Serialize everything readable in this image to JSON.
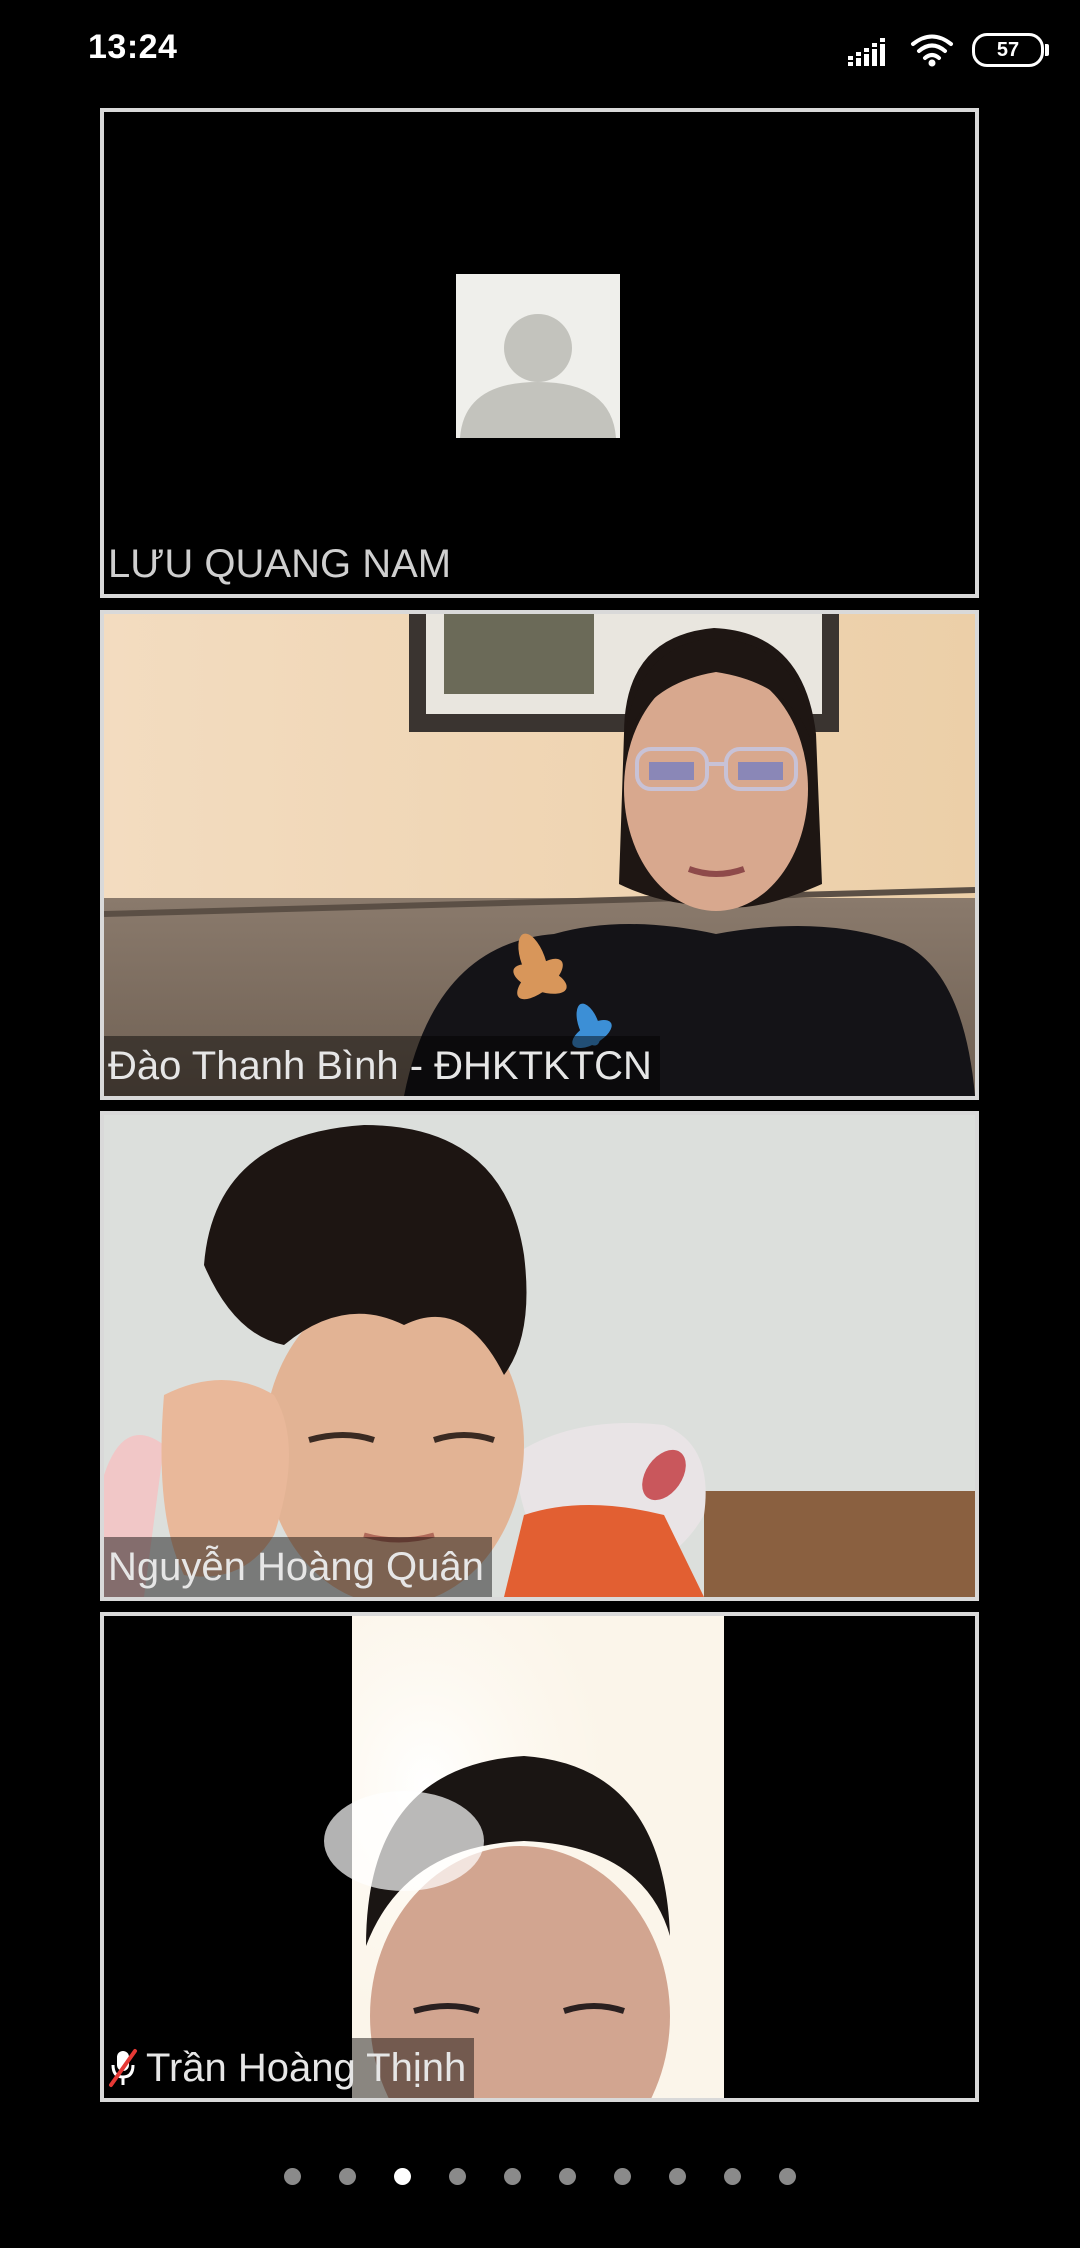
{
  "status_bar": {
    "time": "13:24",
    "battery": "57",
    "icons": [
      "signal-icon",
      "wifi-icon",
      "battery-icon"
    ]
  },
  "participants": [
    {
      "name": "LƯU QUANG NAM",
      "video": "avatar-placeholder",
      "muted": false
    },
    {
      "name": "Đào Thanh Bình - ĐHKTKTCN",
      "video": "camera",
      "muted": false
    },
    {
      "name": "Nguyễn Hoàng Quân",
      "video": "camera",
      "muted": false
    },
    {
      "name": "Trần Hoàng Thịnh",
      "video": "camera",
      "muted": true
    }
  ],
  "pagination": {
    "total": 10,
    "active": 3
  },
  "colors": {
    "background": "#000000",
    "tile_border": "#d9d9d9",
    "dot_active": "#ffffff",
    "dot_inactive": "#8a8a8a",
    "muted_icon": "#e53935"
  }
}
